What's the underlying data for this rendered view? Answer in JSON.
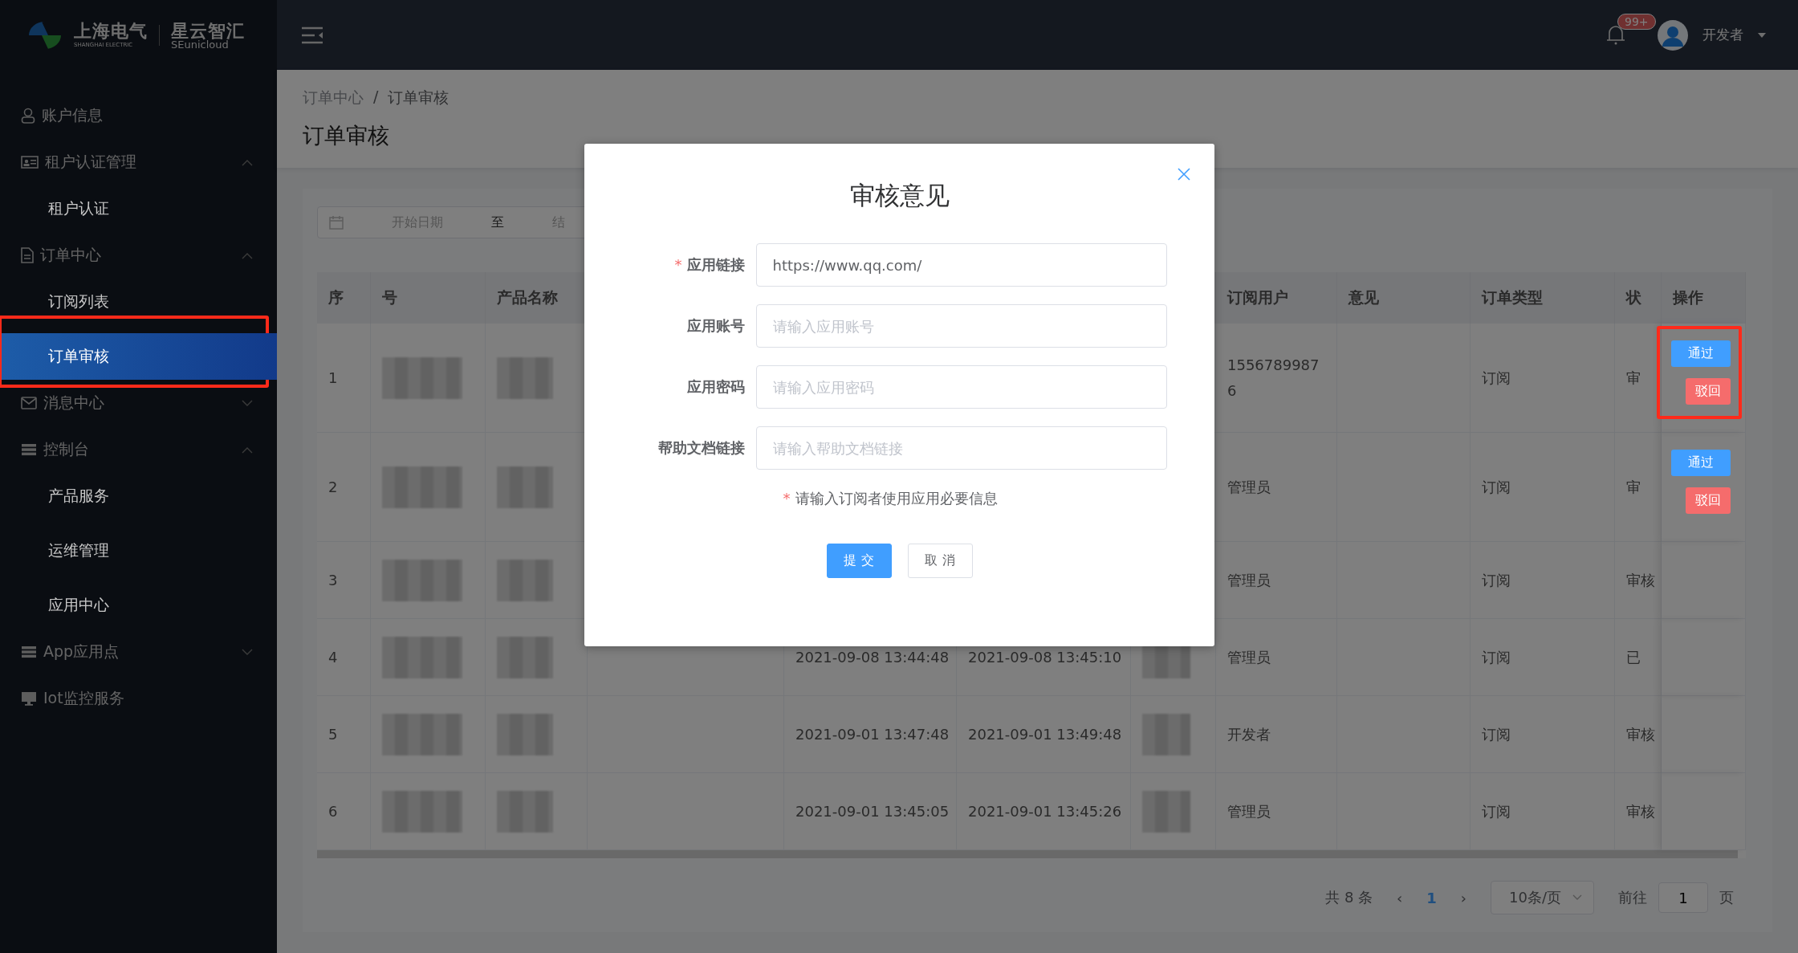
{
  "header": {
    "logo": {
      "company": "上海电气",
      "company_en": "SHANGHAI ELECTRIC",
      "product": "星云智汇",
      "product_en": "SEunicloud"
    },
    "notifications": {
      "badge": "99+"
    },
    "user": {
      "name": "开发者"
    }
  },
  "sidebar": {
    "items": [
      {
        "label": "账户信息",
        "selected": false
      },
      {
        "label": "租户认证管理",
        "selected": false,
        "expanded": true,
        "children": [
          {
            "label": "租户认证",
            "selected": false,
            "highlighted": false
          }
        ]
      },
      {
        "label": "订单中心",
        "selected": false,
        "expanded": true,
        "children": [
          {
            "label": "订阅列表",
            "selected": false,
            "highlighted": false
          },
          {
            "label": "订单审核",
            "selected": true,
            "highlighted": true
          }
        ]
      },
      {
        "label": "消息中心",
        "selected": false,
        "expanded": false
      },
      {
        "label": "控制台",
        "selected": false,
        "expanded": true,
        "children": [
          {
            "label": "产品服务",
            "selected": false,
            "highlighted": false
          },
          {
            "label": "运维管理",
            "selected": false,
            "highlighted": false
          },
          {
            "label": "应用中心",
            "selected": false,
            "highlighted": false
          }
        ]
      },
      {
        "label": "App应用点",
        "selected": false,
        "expanded": false
      },
      {
        "label": "Iot监控服务",
        "selected": false
      }
    ]
  },
  "breadcrumb": {
    "items": [
      "订单中心",
      "订单审核"
    ],
    "separator": "/"
  },
  "page_title": "订单审核",
  "date_range": {
    "start_placeholder": "开始日期",
    "separator": "至",
    "end_placeholder": "结"
  },
  "table": {
    "columns": [
      "序",
      "号",
      "产品名称",
      null,
      null,
      null,
      null,
      "订阅用户",
      "意见",
      "订单类型",
      "状",
      "操作"
    ],
    "rows": [
      {
        "no": "1",
        "redacted": true,
        "user": "1556789987 6",
        "type": "订阅",
        "status": "审",
        "highlighted": true,
        "actions": [
          {
            "label": "通过",
            "kind": "approve"
          },
          {
            "label": "驳回",
            "kind": "reject"
          }
        ]
      },
      {
        "no": "2",
        "redacted": true,
        "user": "管理员",
        "type": "订阅",
        "status": "审",
        "highlighted": false,
        "actions": [
          {
            "label": "通过",
            "kind": "approve"
          },
          {
            "label": "驳回",
            "kind": "reject"
          }
        ]
      },
      {
        "no": "3",
        "redacted": true,
        "user": "管理员",
        "type": "订阅",
        "status": "审核",
        "highlighted": false
      },
      {
        "no": "4",
        "redacted": true,
        "created": "2021-09-08 13:44:48",
        "updated": "2021-09-08 13:45:10",
        "user": "管理员",
        "type": "订阅",
        "status": "已",
        "highlighted": false
      },
      {
        "no": "5",
        "redacted": true,
        "created": "2021-09-01 13:47:48",
        "updated": "2021-09-01 13:49:48",
        "user": "开发者",
        "type": "订阅",
        "status": "审核",
        "highlighted": false
      },
      {
        "no": "6",
        "redacted": true,
        "created": "2021-09-01 13:45:05",
        "updated": "2021-09-01 13:45:26",
        "user": "管理员",
        "type": "订阅",
        "status": "审核",
        "highlighted": false
      }
    ]
  },
  "pagination": {
    "total": "共 8 条",
    "prev": "‹",
    "pages": [
      {
        "label": "1",
        "selected": true
      }
    ],
    "next": "›",
    "page_size": "10条/页",
    "goto_label": "前往",
    "goto_value": "1",
    "goto_suffix": "页"
  },
  "dialog": {
    "title": "审核意见",
    "required_mark": "*",
    "fields": [
      {
        "label": "应用链接",
        "required": true,
        "value": "https://www.qq.com/"
      },
      {
        "label": "应用账号",
        "required": false,
        "placeholder": "请输入应用账号"
      },
      {
        "label": "应用密码",
        "required": false,
        "placeholder": "请输入应用密码"
      },
      {
        "label": "帮助文档链接",
        "required": false,
        "placeholder": "请输入帮助文档链接"
      }
    ],
    "note": {
      "required": true,
      "text": "请输入订阅者使用应用必要信息"
    },
    "buttons": [
      {
        "label": "提 交",
        "kind": "primary"
      },
      {
        "label": "取 消",
        "kind": "default"
      }
    ]
  }
}
